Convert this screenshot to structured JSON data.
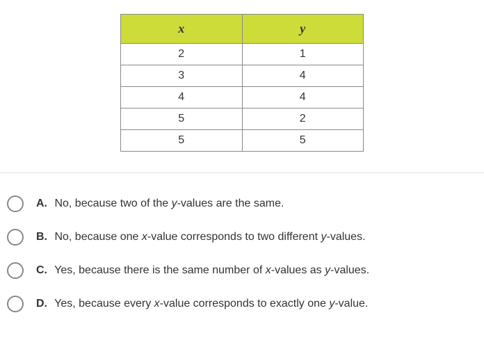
{
  "table": {
    "headers": {
      "x": "x",
      "y": "y"
    },
    "rows": [
      {
        "x": "2",
        "y": "1"
      },
      {
        "x": "3",
        "y": "4"
      },
      {
        "x": "4",
        "y": "4"
      },
      {
        "x": "5",
        "y": "2"
      },
      {
        "x": "5",
        "y": "5"
      }
    ]
  },
  "options": {
    "a": {
      "letter": "A.",
      "pre": "No, because two of the ",
      "var1": "y",
      "post": "-values are the same."
    },
    "b": {
      "letter": "B.",
      "pre": "No, because one ",
      "var1": "x",
      "mid": "-value corresponds to two different ",
      "var2": "y",
      "post": "-values."
    },
    "c": {
      "letter": "C.",
      "pre": "Yes, because there is the same number of ",
      "var1": "x",
      "mid": "-values as ",
      "var2": "y",
      "post": "-values."
    },
    "d": {
      "letter": "D.",
      "pre": "Yes, because every ",
      "var1": "x",
      "mid": "-value corresponds to exactly one ",
      "var2": "y",
      "post": "-value."
    }
  }
}
